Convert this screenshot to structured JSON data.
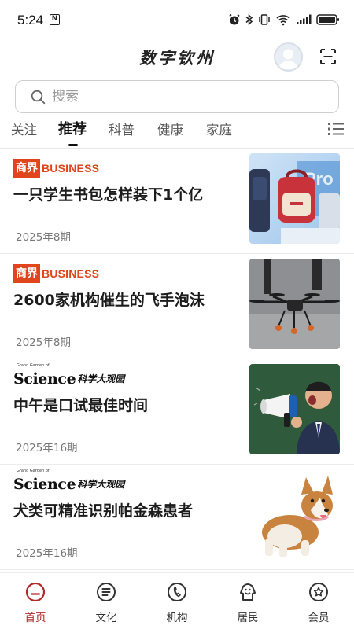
{
  "status_bar": {
    "time": "5:24",
    "n_badge": "N",
    "icons": [
      "alarm-icon",
      "bluetooth-icon",
      "vibrate-icon",
      "wifi-icon",
      "signal-icon",
      "battery-icon"
    ]
  },
  "header": {
    "title": "数字钦州",
    "avatar_icon": "default-user-avatar",
    "scan_icon": "scan-icon"
  },
  "search": {
    "placeholder": "搜索"
  },
  "tabs": [
    {
      "label": "关注",
      "active": false
    },
    {
      "label": "推荐",
      "active": true
    },
    {
      "label": "科普",
      "active": false
    },
    {
      "label": "健康",
      "active": false
    },
    {
      "label": "家庭",
      "active": false
    }
  ],
  "articles": [
    {
      "source_cn": "商界",
      "source_en": "BUSINESS",
      "title": "一只学生书包怎样装下1个亿",
      "issue": "2025年8期",
      "thumb": "backpacks-photo"
    },
    {
      "source_cn": "商界",
      "source_en": "BUSINESS",
      "title": "2600家机构催生的飞手泡沫",
      "issue": "2025年8期",
      "thumb": "drone-photo"
    },
    {
      "source_cn": "科学大观园",
      "source_en": "Science",
      "source_sub": "Grand Garden of",
      "title": "中午是口试最佳时间",
      "issue": "2025年16期",
      "thumb": "megaphone-man-photo"
    },
    {
      "source_cn": "科学大观园",
      "source_en": "Science",
      "source_sub": "Grand Garden of",
      "title": "犬类可精准识别帕金森患者",
      "issue": "2025年16期",
      "thumb": "corgi-photo"
    }
  ],
  "bottom_nav": [
    {
      "label": "首页",
      "icon": "home-icon",
      "active": true
    },
    {
      "label": "文化",
      "icon": "culture-icon",
      "active": false
    },
    {
      "label": "机构",
      "icon": "institution-icon",
      "active": false
    },
    {
      "label": "居民",
      "icon": "resident-icon",
      "active": false
    },
    {
      "label": "会员",
      "icon": "member-icon",
      "active": false
    }
  ],
  "colors": {
    "accent": "#b12a2a",
    "business_brand": "#e0451c"
  }
}
